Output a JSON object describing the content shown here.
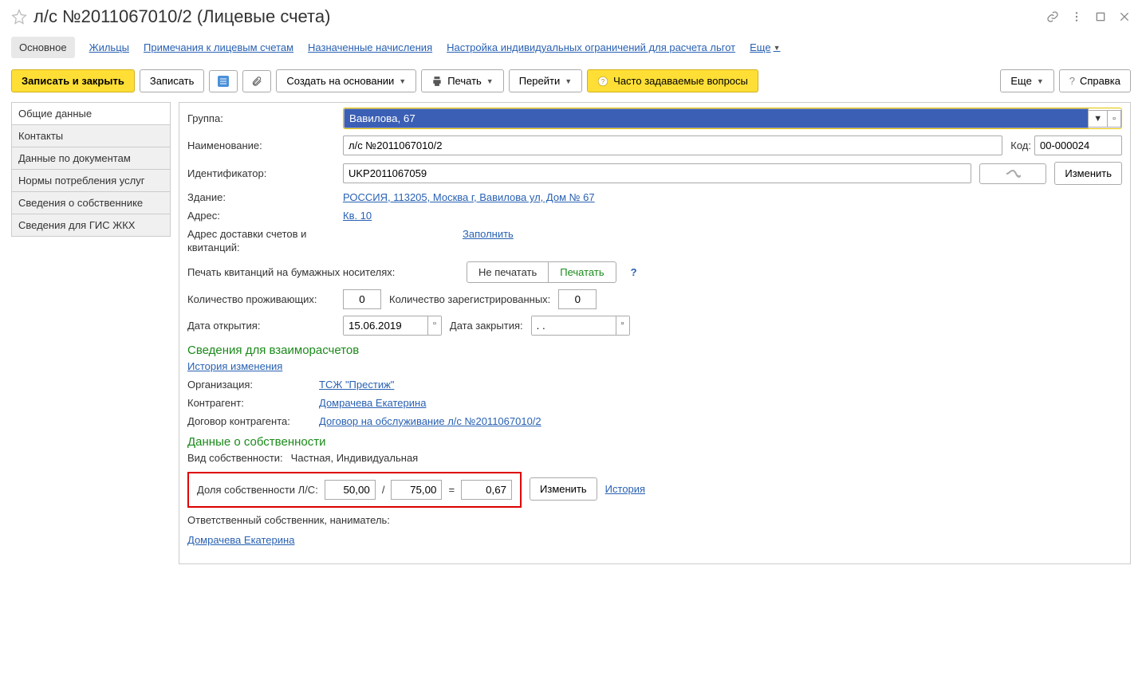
{
  "title": "л/с №2011067010/2 (Лицевые счета)",
  "nav": {
    "main": "Основное",
    "tenants": "Жильцы",
    "notes": "Примечания к лицевым счетам",
    "assigned": "Назначенные начисления",
    "limits": "Настройка индивидуальных ограничений для расчета льгот",
    "more": "Еще"
  },
  "toolbar": {
    "save_close": "Записать и закрыть",
    "save": "Записать",
    "create_based": "Создать на основании",
    "print": "Печать",
    "goto": "Перейти",
    "faq": "Часто задаваемые вопросы",
    "more": "Еще",
    "help": "Справка"
  },
  "sidebar": {
    "general": "Общие данные",
    "contacts": "Контакты",
    "docs": "Данные по документам",
    "norms": "Нормы потребления услуг",
    "owner": "Сведения о собственнике",
    "gis": "Сведения для ГИС ЖКХ"
  },
  "labels": {
    "group": "Группа:",
    "name": "Наименование:",
    "code": "Код:",
    "identifier": "Идентификатор:",
    "change": "Изменить",
    "building": "Здание:",
    "address": "Адрес:",
    "delivery": "Адрес доставки счетов и квитанций:",
    "fill": "Заполнить",
    "print_paper": "Печать квитанций на бумажных носителях:",
    "dont_print": "Не печатать",
    "do_print": "Печатать",
    "living": "Количество проживающих:",
    "registered": "Количество зарегистрированных:",
    "open_date": "Дата открытия:",
    "close_date": "Дата закрытия:",
    "settlement_title": "Сведения для взаиморасчетов",
    "history": "История изменения",
    "org": "Организация:",
    "counterparty": "Контрагент:",
    "contract": "Договор контрагента:",
    "ownership_title": "Данные о собственности",
    "ownership_type_label": "Вид собственности:",
    "share_label": "Доля собственности Л/С:",
    "history2": "История",
    "resp_owner": "Ответственный собственник, наниматель:"
  },
  "values": {
    "group": "Вавилова, 67",
    "name": "л/с №2011067010/2",
    "code": "00-000024",
    "identifier": "UKP2011067059",
    "building": "РОССИЯ, 113205, Москва г, Вавилова ул, Дом № 67",
    "address": "Кв. 10",
    "living": "0",
    "registered": "0",
    "open_date": "15.06.2019",
    "close_date": ". .",
    "org": "ТСЖ \"Престиж\"",
    "counterparty": "Домрачева Екатерина",
    "contract": "Договор на обслуживание л/с №2011067010/2",
    "ownership_type": "Частная, Индивидуальная",
    "share_num": "50,00",
    "share_den": "75,00",
    "share_res": "0,67",
    "resp_owner": "Домрачева Екатерина"
  }
}
